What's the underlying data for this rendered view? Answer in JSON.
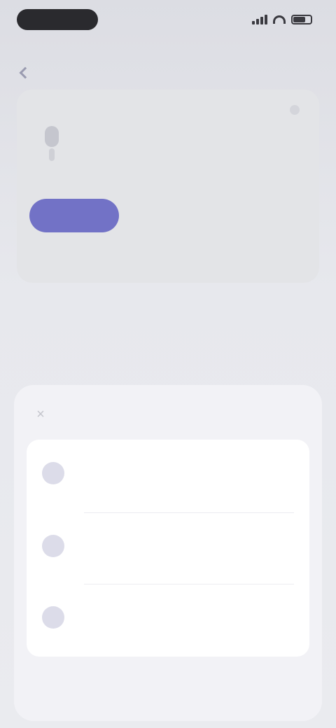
{
  "status_bar": {
    "time": ""
  },
  "header": {
    "link": ""
  },
  "card": {
    "caption": "",
    "title": "",
    "subtitle": "",
    "primary_label": "",
    "secondary_label": "",
    "tertiary_label": "",
    "footer": ""
  },
  "section": {
    "title": "",
    "text": "",
    "action": ""
  },
  "sheet": {
    "close_glyph": "×",
    "title": "",
    "items": [
      {
        "icon": "",
        "title": "",
        "description": ""
      },
      {
        "icon": "",
        "title": "",
        "description": ""
      },
      {
        "icon": "",
        "title": "",
        "description": ""
      }
    ]
  },
  "colors": {
    "accent": "#7272c6",
    "sheet_background": "#f2f2f6",
    "list_background": "#ffffff"
  }
}
